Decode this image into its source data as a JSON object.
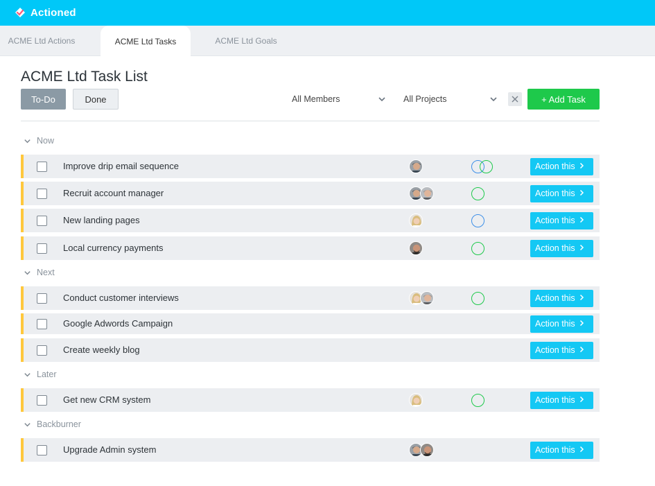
{
  "app": {
    "name": "Actioned",
    "brand_color": "#00c8f8"
  },
  "tabs": [
    {
      "label": "ACME Ltd Actions",
      "active": false
    },
    {
      "label": "ACME Ltd Tasks",
      "active": true
    },
    {
      "label": "ACME Ltd Goals",
      "active": false
    }
  ],
  "page": {
    "title": "ACME Ltd Task List"
  },
  "toolbar": {
    "todo_label": "To-Do",
    "done_label": "Done",
    "members_value": "All Members",
    "projects_value": "All Projects",
    "add_label": "+ Add Task"
  },
  "sections": [
    {
      "label": "Now"
    },
    {
      "label": "Next"
    },
    {
      "label": "Later"
    },
    {
      "label": "Backburner"
    }
  ],
  "action_label": "Action this",
  "tasks": [
    {
      "title": "Improve drip email sequence",
      "avatars": [
        "man-dark-hair"
      ],
      "status": [
        "blue",
        "green"
      ]
    },
    {
      "title": "Recruit account manager",
      "avatars": [
        "man-dark-hair",
        "man-grey-hair"
      ],
      "status": [
        "green"
      ]
    },
    {
      "title": "New landing pages",
      "avatars": [
        "woman-blonde"
      ],
      "status": [
        "blue"
      ]
    },
    {
      "title": "Local currency payments",
      "avatars": [
        "man-bald"
      ],
      "status": [
        "green"
      ]
    },
    {
      "title": "Conduct customer interviews",
      "avatars": [
        "woman-blonde",
        "man-grey-hair"
      ],
      "status": [
        "green"
      ]
    },
    {
      "title": "Google Adwords Campaign",
      "avatars": [],
      "status": []
    },
    {
      "title": "Create weekly blog",
      "avatars": [],
      "status": []
    },
    {
      "title": "Get new CRM system",
      "avatars": [
        "woman-blonde"
      ],
      "status": [
        "green"
      ]
    },
    {
      "title": "Upgrade Admin system",
      "avatars": [
        "man-dark-hair",
        "man-bald"
      ],
      "status": []
    }
  ],
  "colors": {
    "accent": "#ffc83d",
    "ring_blue": "#3d8fe8",
    "ring_green": "#1ec94b",
    "action": "#14c8f4",
    "add": "#1ec94b"
  }
}
